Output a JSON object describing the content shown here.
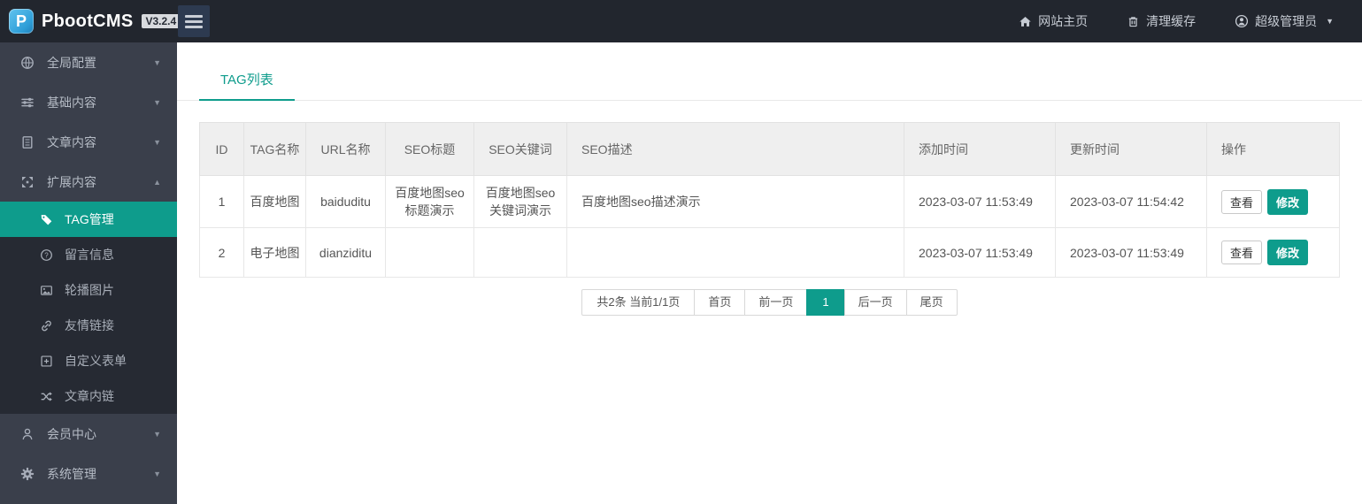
{
  "colors": {
    "accent": "#0e9c8c",
    "topbar_bg": "#22262e",
    "sidebar_bg": "#3a3f4b",
    "submenu_bg": "#262a33"
  },
  "icons": {
    "chevron_down": "▼",
    "chevron_up": "▲"
  },
  "header": {
    "brand": "PbootCMS",
    "logo_letter": "P",
    "version": "V3.2.4",
    "nav": [
      {
        "label": "网站主页",
        "icon": "home-icon"
      },
      {
        "label": "清理缓存",
        "icon": "trash-icon"
      },
      {
        "label": "超级管理员",
        "icon": "user-circle-icon"
      }
    ]
  },
  "sidebar": {
    "items": [
      {
        "label": "全局配置",
        "icon": "globe-icon"
      },
      {
        "label": "基础内容",
        "icon": "sliders-icon"
      },
      {
        "label": "文章内容",
        "icon": "document-icon"
      },
      {
        "label": "扩展内容",
        "icon": "arrows-expand-icon",
        "expanded": true,
        "children": [
          {
            "label": "TAG管理",
            "icon": "tag-icon",
            "active": true
          },
          {
            "label": "留言信息",
            "icon": "question-circle-icon"
          },
          {
            "label": "轮播图片",
            "icon": "image-icon"
          },
          {
            "label": "友情链接",
            "icon": "link-icon"
          },
          {
            "label": "自定义表单",
            "icon": "plus-square-icon"
          },
          {
            "label": "文章内链",
            "icon": "shuffle-icon"
          }
        ]
      },
      {
        "label": "会员中心",
        "icon": "member-icon"
      },
      {
        "label": "系统管理",
        "icon": "gear-icon"
      }
    ]
  },
  "main": {
    "tab": "TAG列表",
    "table": {
      "headers": [
        "ID",
        "TAG名称",
        "URL名称",
        "SEO标题",
        "SEO关键词",
        "SEO描述",
        "添加时间",
        "更新时间",
        "操作"
      ],
      "rows": [
        {
          "id": "1",
          "name": "百度地图",
          "url": "baiduditu",
          "seo_title": "百度地图seo标题演示",
          "seo_keywords": "百度地图seo关键词演示",
          "seo_desc": "百度地图seo描述演示",
          "added": "2023-03-07 11:53:49",
          "updated": "2023-03-07 11:54:42"
        },
        {
          "id": "2",
          "name": "电子地图",
          "url": "dianziditu",
          "seo_title": "",
          "seo_keywords": "",
          "seo_desc": "",
          "added": "2023-03-07 11:53:49",
          "updated": "2023-03-07 11:53:49"
        }
      ],
      "actions": {
        "view": "查看",
        "edit": "修改"
      }
    },
    "pagination": {
      "info": "共2条 当前1/1页",
      "first": "首页",
      "prev": "前一页",
      "current": "1",
      "next": "后一页",
      "last": "尾页"
    }
  }
}
